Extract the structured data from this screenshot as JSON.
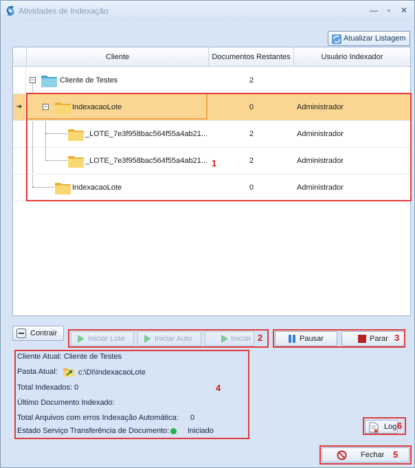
{
  "window": {
    "title": "Atividades de Indexação"
  },
  "toolbar": {
    "refresh_label": "Atualizar Listagem"
  },
  "grid": {
    "columns": [
      "Cliente",
      "Documentos Restantes",
      "Usuário Indexador"
    ],
    "rows": [
      {
        "name": "Cliente de Testes",
        "docs": "2",
        "user": ""
      },
      {
        "name": "IndexacaoLote",
        "docs": "0",
        "user": "Administrador"
      },
      {
        "name": "_LOTE_7e3f958bac564f55a4ab21...",
        "docs": "2",
        "user": "Administrador"
      },
      {
        "name": "_LOTE_7e3f958bac564f55a4ab21...",
        "docs": "2",
        "user": "Administrador"
      },
      {
        "name": "IndexacaoLote",
        "docs": "0",
        "user": "Administrador"
      }
    ]
  },
  "actions": {
    "contrair": "Contrair",
    "iniciar_lote": "Iniciar Lote",
    "iniciar_auto": "Iniciar Auto",
    "iniciar": "Iniciar",
    "pausar": "Pausar",
    "parar": "Parar",
    "log": "Log",
    "fechar": "Fechar"
  },
  "info": {
    "cliente_atual": "Cliente Atual: Cliente de Testes",
    "pasta_label": "Pasta Atual:",
    "pasta_value": "c:\\DI\\IndexacaoLote",
    "total_indexados": "Total Indexados: 0",
    "ultimo_documento": "Último Documento Indexado:",
    "erros_label": "Total Arquivos com erros Indexação Automática:",
    "erros_value": "0",
    "estado_label": "Estado Serviço Transferência de Documento:",
    "estado_value": "Iniciado"
  },
  "annotations": [
    "1",
    "2",
    "3",
    "4",
    "5",
    "6"
  ],
  "colors": {
    "selected_row": "#fbd693",
    "annotation_red": "#e23a3a",
    "status_green": "#22b24c"
  }
}
